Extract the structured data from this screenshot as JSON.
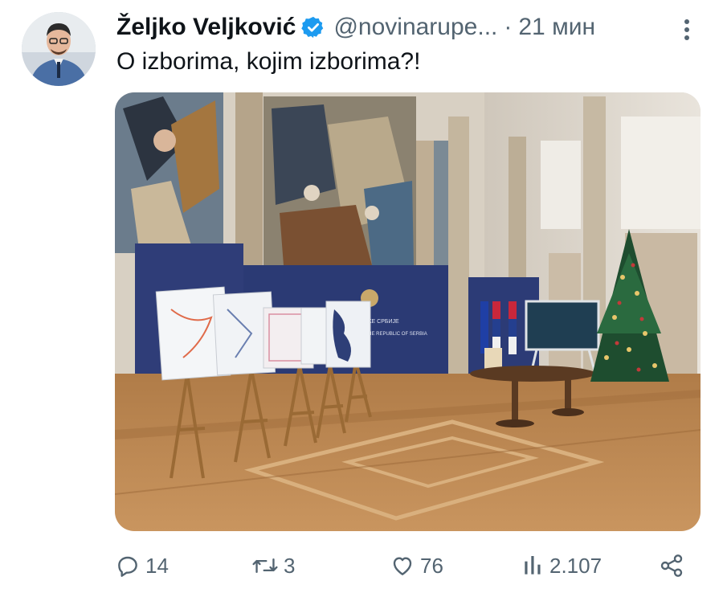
{
  "author": {
    "name": "Željko Veljković",
    "handle": "@novinarupe...",
    "separator": "·",
    "time": "21 мин",
    "verified": true
  },
  "tweet": {
    "text": "O izborima, kojim izborima?!"
  },
  "media": {
    "poster_text_line1": "ВЛАДА РЕПУБЛИКЕ СРБИЈЕ",
    "poster_text_line2": "GOVERNMENT OF THE REPUBLIC OF SERBIA"
  },
  "actions": {
    "replies": "14",
    "retweets": "3",
    "likes": "76",
    "views": "2.107"
  },
  "colors": {
    "text_primary": "#0f1419",
    "text_secondary": "#536471",
    "verified_blue": "#1d9bf0"
  },
  "icons": [
    "verified-badge-icon",
    "more-icon",
    "reply-icon",
    "retweet-icon",
    "like-icon",
    "views-icon",
    "share-icon"
  ]
}
